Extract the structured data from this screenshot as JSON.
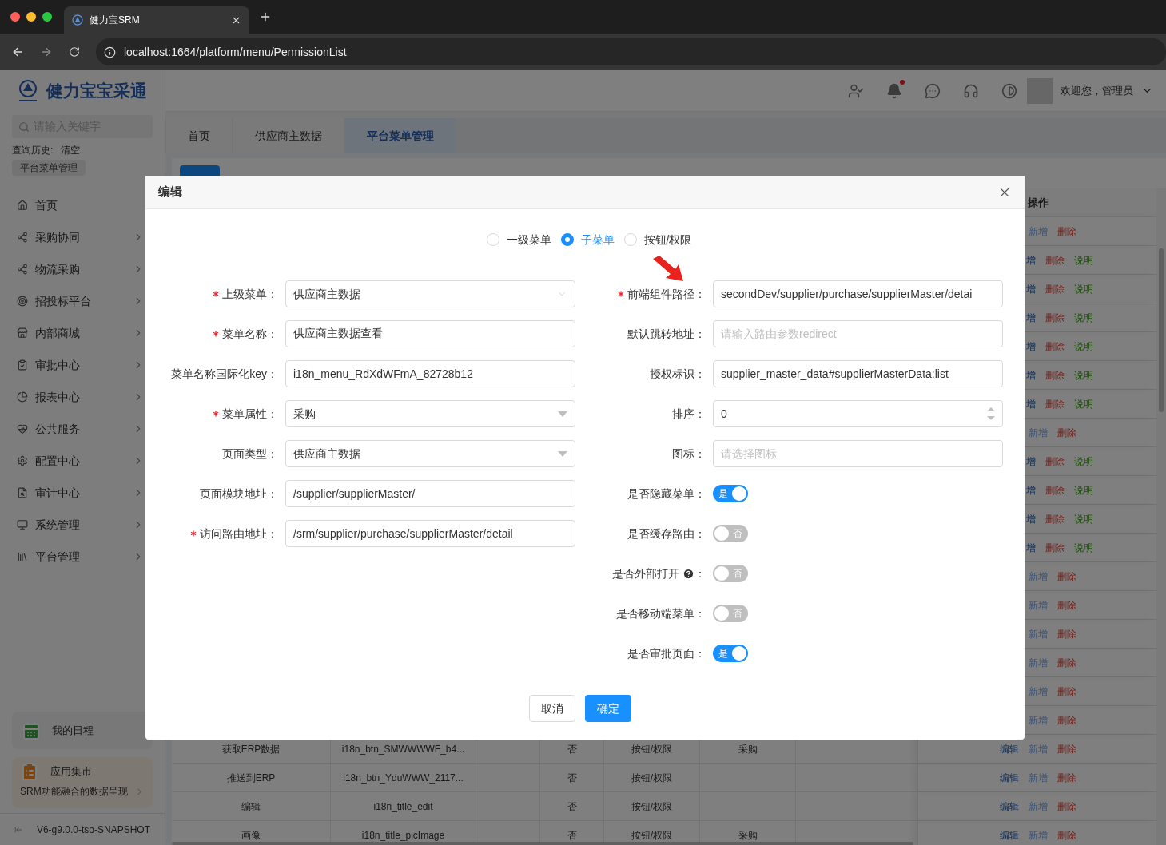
{
  "browser": {
    "tab_title": "健力宝SRM",
    "url": "localhost:1664/platform/menu/PermissionList"
  },
  "brand": {
    "name": "健力宝宝采通"
  },
  "sidebar": {
    "search": {
      "placeholder": "请输入关键字"
    },
    "history_label": "查询历史:",
    "clear_label": "清空",
    "history_tags": [
      "平台菜单管理"
    ],
    "items": [
      {
        "label": "首页",
        "expandable": false
      },
      {
        "label": "采购协同",
        "expandable": true
      },
      {
        "label": "物流采购",
        "expandable": true
      },
      {
        "label": "招投标平台",
        "expandable": true
      },
      {
        "label": "内部商城",
        "expandable": true
      },
      {
        "label": "审批中心",
        "expandable": true
      },
      {
        "label": "报表中心",
        "expandable": true
      },
      {
        "label": "公共服务",
        "expandable": true
      },
      {
        "label": "配置中心",
        "expandable": true
      },
      {
        "label": "审计中心",
        "expandable": true
      },
      {
        "label": "系统管理",
        "expandable": true
      },
      {
        "label": "平台管理",
        "expandable": true
      }
    ],
    "schedule": {
      "label": "我的日程"
    },
    "market": {
      "title": "应用集市",
      "subtitle": "SRM功能融合的数据呈现"
    },
    "version": "V6-g9.0.0-tso-SNAPSHOT"
  },
  "header": {
    "unread": true,
    "greeting": "欢迎您，管理员"
  },
  "tabs": [
    {
      "label": "首页",
      "selected": false
    },
    {
      "label": "供应商主数据",
      "selected": false
    },
    {
      "label": "平台菜单管理",
      "selected": true
    }
  ],
  "table": {
    "ops_header": "操作",
    "rows": [
      {
        "ops": [
          {
            "label": "新增",
            "kind": "add",
            "disabled": true
          },
          {
            "label": "删除",
            "kind": "delete"
          }
        ]
      },
      {
        "ops": [
          {
            "label": "增",
            "kind": "add",
            "disabled": false
          },
          {
            "label": "删除",
            "kind": "delete"
          },
          {
            "label": "说明",
            "kind": "explain"
          }
        ]
      },
      {
        "ops": [
          {
            "label": "增",
            "kind": "add",
            "disabled": false
          },
          {
            "label": "删除",
            "kind": "delete"
          },
          {
            "label": "说明",
            "kind": "explain"
          }
        ]
      },
      {
        "ops": [
          {
            "label": "增",
            "kind": "add",
            "disabled": false
          },
          {
            "label": "删除",
            "kind": "delete"
          },
          {
            "label": "说明",
            "kind": "explain"
          }
        ]
      },
      {
        "ops": [
          {
            "label": "增",
            "kind": "add",
            "disabled": false
          },
          {
            "label": "删除",
            "kind": "delete"
          },
          {
            "label": "说明",
            "kind": "explain"
          }
        ]
      },
      {
        "ops": [
          {
            "label": "增",
            "kind": "add",
            "disabled": false
          },
          {
            "label": "删除",
            "kind": "delete"
          },
          {
            "label": "说明",
            "kind": "explain"
          }
        ]
      },
      {
        "ops": [
          {
            "label": "增",
            "kind": "add",
            "disabled": false
          },
          {
            "label": "删除",
            "kind": "delete"
          },
          {
            "label": "说明",
            "kind": "explain"
          }
        ]
      },
      {
        "ops": [
          {
            "label": "新增",
            "kind": "add",
            "disabled": true
          },
          {
            "label": "删除",
            "kind": "delete"
          }
        ]
      },
      {
        "ops": [
          {
            "label": "增",
            "kind": "add",
            "disabled": false
          },
          {
            "label": "删除",
            "kind": "delete"
          },
          {
            "label": "说明",
            "kind": "explain"
          }
        ]
      },
      {
        "ops": [
          {
            "label": "增",
            "kind": "add",
            "disabled": false
          },
          {
            "label": "删除",
            "kind": "delete"
          },
          {
            "label": "说明",
            "kind": "explain"
          }
        ]
      },
      {
        "ops": [
          {
            "label": "增",
            "kind": "add",
            "disabled": false
          },
          {
            "label": "删除",
            "kind": "delete"
          },
          {
            "label": "说明",
            "kind": "explain"
          }
        ]
      },
      {
        "ops": [
          {
            "label": "增",
            "kind": "add",
            "disabled": false
          },
          {
            "label": "删除",
            "kind": "delete"
          },
          {
            "label": "说明",
            "kind": "explain"
          }
        ]
      },
      {
        "ops": [
          {
            "label": "新增",
            "kind": "add",
            "disabled": true
          },
          {
            "label": "删除",
            "kind": "delete"
          }
        ]
      },
      {
        "ops": [
          {
            "label": "新增",
            "kind": "add",
            "disabled": true
          },
          {
            "label": "删除",
            "kind": "delete"
          }
        ]
      },
      {
        "ops": [
          {
            "label": "新增",
            "kind": "add",
            "disabled": true
          },
          {
            "label": "删除",
            "kind": "delete"
          }
        ]
      },
      {
        "ops": [
          {
            "label": "新增",
            "kind": "add",
            "disabled": true
          },
          {
            "label": "删除",
            "kind": "delete"
          }
        ]
      },
      {
        "ops": [
          {
            "label": "新增",
            "kind": "add",
            "disabled": true
          },
          {
            "label": "删除",
            "kind": "delete"
          }
        ]
      },
      {
        "ops": [
          {
            "label": "新增",
            "kind": "add",
            "disabled": true
          },
          {
            "label": "删除",
            "kind": "delete"
          }
        ]
      },
      {
        "column_1": "获取ERP数据",
        "column_2": "i18n_btn_SMWWWWF_b4...",
        "column_4": "否",
        "column_5": "按钮/权限",
        "column_6": "采购",
        "ops": [
          {
            "label": "编辑",
            "kind": "edit"
          },
          {
            "label": "新增",
            "kind": "add",
            "disabled": true
          },
          {
            "label": "删除",
            "kind": "delete"
          }
        ]
      },
      {
        "column_1": "推送到ERP",
        "column_2": "i18n_btn_YduWWW_2117...",
        "column_4": "否",
        "column_5": "按钮/权限",
        "ops": [
          {
            "label": "编辑",
            "kind": "edit"
          },
          {
            "label": "新增",
            "kind": "add",
            "disabled": true
          },
          {
            "label": "删除",
            "kind": "delete"
          }
        ]
      },
      {
        "column_1": "编辑",
        "column_2": "i18n_title_edit",
        "column_4": "否",
        "column_5": "按钮/权限",
        "ops": [
          {
            "label": "编辑",
            "kind": "edit"
          },
          {
            "label": "新增",
            "kind": "add",
            "disabled": true
          },
          {
            "label": "删除",
            "kind": "delete"
          }
        ]
      },
      {
        "column_1": "画像",
        "column_2": "i18n_title_picImage",
        "column_4": "否",
        "column_5": "按钮/权限",
        "column_6": "采购",
        "ops": [
          {
            "label": "编辑",
            "kind": "edit"
          },
          {
            "label": "新增",
            "kind": "add",
            "disabled": true
          },
          {
            "label": "删除",
            "kind": "delete"
          }
        ]
      }
    ]
  },
  "dialog": {
    "title": "编辑",
    "menu_types": [
      {
        "label": "一级菜单",
        "selected": false
      },
      {
        "label": "子菜单",
        "selected": true
      },
      {
        "label": "按钮/权限",
        "selected": false
      }
    ],
    "left_fields": [
      {
        "label": "上级菜单：",
        "required": true,
        "kind": "tree_select",
        "value": "供应商主数据"
      },
      {
        "label": "菜单名称：",
        "required": true,
        "kind": "input",
        "value": "供应商主数据查看"
      },
      {
        "label": "菜单名称国际化key：",
        "required": false,
        "kind": "input",
        "value": "i18n_menu_RdXdWFmA_82728b12"
      },
      {
        "label": "菜单属性：",
        "required": true,
        "kind": "select",
        "value": "采购"
      },
      {
        "label": "页面类型：",
        "required": false,
        "kind": "select",
        "value": "供应商主数据"
      },
      {
        "label": "页面模块地址：",
        "required": false,
        "kind": "input",
        "value": "/supplier/supplierMaster/"
      },
      {
        "label": "访问路由地址：",
        "required": true,
        "kind": "input",
        "value": "/srm/supplier/purchase/supplierMaster/detail"
      }
    ],
    "right_fields": [
      {
        "label": "前端组件路径：",
        "required": true,
        "kind": "input",
        "value": "secondDev/supplier/purchase/supplierMaster/detai"
      },
      {
        "label": "默认跳转地址：",
        "required": false,
        "kind": "input",
        "placeholder": "请输入路由参数redirect"
      },
      {
        "label": "授权标识：",
        "required": false,
        "kind": "input",
        "value": "supplier_master_data#supplierMasterData:list"
      },
      {
        "label": "排序：",
        "required": false,
        "kind": "number",
        "value": "0"
      },
      {
        "label": "图标：",
        "required": false,
        "kind": "input",
        "placeholder": "请选择图标"
      },
      {
        "label": "是否隐藏菜单：",
        "required": false,
        "kind": "switch",
        "on": true,
        "text": "是"
      },
      {
        "label": "是否缓存路由：",
        "required": false,
        "kind": "switch",
        "on": false,
        "text": "否"
      },
      {
        "label": "是否外部打开",
        "label_end": "：",
        "help": true,
        "required": false,
        "kind": "switch",
        "on": false,
        "text": "否"
      },
      {
        "label": "是否移动端菜单：",
        "required": false,
        "kind": "switch",
        "on": false,
        "text": "否"
      },
      {
        "label": "是否审批页面：",
        "required": false,
        "kind": "switch",
        "on": true,
        "text": "是"
      }
    ],
    "cancel": "取消",
    "ok": "确定"
  }
}
